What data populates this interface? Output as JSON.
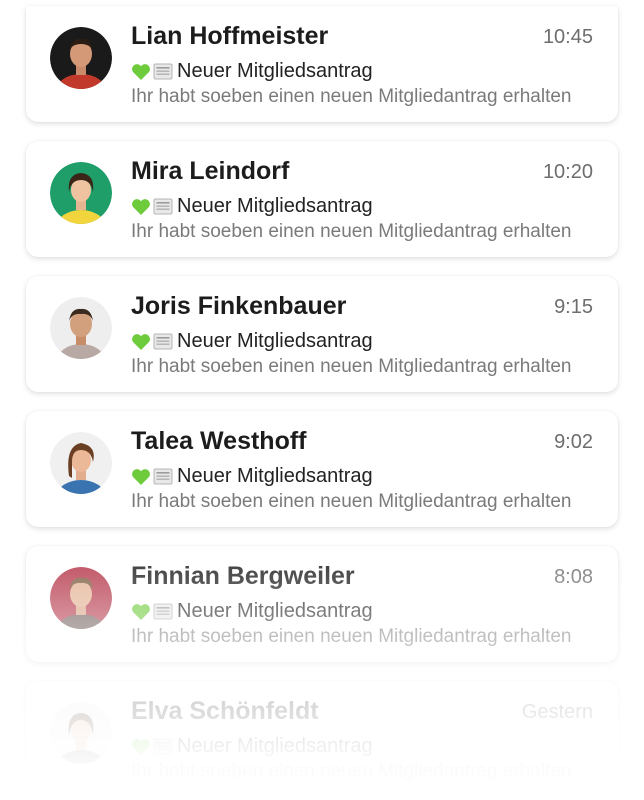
{
  "messages": [
    {
      "name": "Lian Hoffmeister",
      "time": "10:45",
      "subject": "Neuer Mitgliedsantrag",
      "preview": "Ihr habt soeben einen neuen Mitgliedantrag erhalten",
      "avatar_bg": "#1a1a1a",
      "avatar_shirt": "#c0392b"
    },
    {
      "name": "Mira Leindorf",
      "time": "10:20",
      "subject": "Neuer Mitgliedsantrag",
      "preview": "Ihr habt soeben einen neuen Mitgliedantrag erhalten",
      "avatar_bg": "#1f9e6a",
      "avatar_shirt": "#f2d43d"
    },
    {
      "name": "Joris Finkenbauer",
      "time": "9:15",
      "subject": "Neuer Mitgliedsantrag",
      "preview": "Ihr habt soeben einen neuen Mitgliedantrag erhalten",
      "avatar_bg": "#eeeeee",
      "avatar_shirt": "#b8a9a4"
    },
    {
      "name": "Talea Westhoff",
      "time": "9:02",
      "subject": "Neuer Mitgliedsantrag",
      "preview": "Ihr habt soeben einen neuen Mitgliedantrag erhalten",
      "avatar_bg": "#f0f0f0",
      "avatar_shirt": "#3a74b0"
    },
    {
      "name": "Finnian Bergweiler",
      "time": "8:08",
      "subject": "Neuer Mitgliedsantrag",
      "preview": "Ihr habt soeben einen neuen Mitgliedantrag erhalten",
      "avatar_bg": "#b5364a",
      "avatar_shirt": "#6d5a55"
    },
    {
      "name": "Elva Schönfeldt",
      "time": "Gestern",
      "subject": "Neuer Mitgliedsantrag",
      "preview": "Ihr habt soeben einen neuen Mitgliedantrag erhalten",
      "avatar_bg": "#eeeeee",
      "avatar_shirt": "#555555"
    }
  ],
  "icons": {
    "subject_icon_1": "green-heart-icon",
    "subject_icon_2": "newspaper-icon"
  },
  "colors": {
    "heart": "#6ecb3c",
    "name": "#1c1c1c",
    "time": "#6d6d6d",
    "preview": "#7a7a7a"
  }
}
